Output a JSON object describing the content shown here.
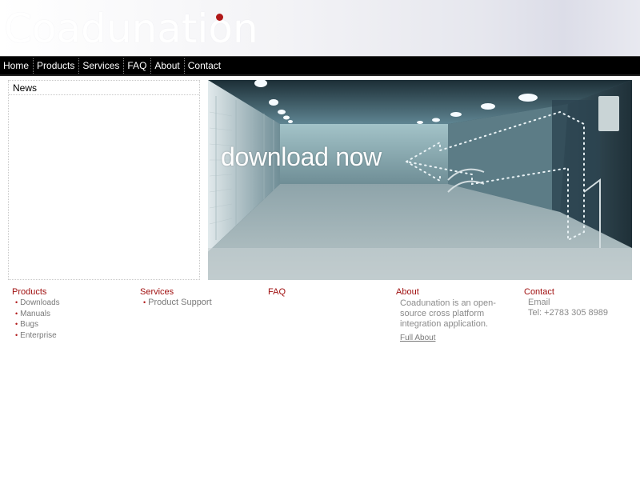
{
  "header": {
    "logo_text": "Coadunation"
  },
  "nav": {
    "items": [
      {
        "label": "Home"
      },
      {
        "label": "Products"
      },
      {
        "label": "Services"
      },
      {
        "label": "FAQ"
      },
      {
        "label": "About"
      },
      {
        "label": "Contact"
      }
    ]
  },
  "news": {
    "title": "News"
  },
  "banner": {
    "text": "download now"
  },
  "footer": {
    "products": {
      "title": "Products",
      "items": [
        "Downloads",
        "Manuals",
        "Bugs",
        "Enterprise"
      ]
    },
    "services": {
      "title": "Services",
      "items": [
        "Product Support"
      ]
    },
    "faq": {
      "title": "FAQ"
    },
    "about": {
      "title": "About",
      "text": "Coadunation is an open-source cross platform integration application.",
      "link": "Full About"
    },
    "contact": {
      "title": "Contact",
      "email": "Email",
      "tel": "Tel: +2783 305 8989"
    }
  },
  "colors": {
    "accent": "#a01010",
    "nav_bg": "#000000",
    "text": "#8a8a8a"
  },
  "icons": {
    "bullet": "bullet-icon",
    "logo_dot": "logo-dot"
  }
}
